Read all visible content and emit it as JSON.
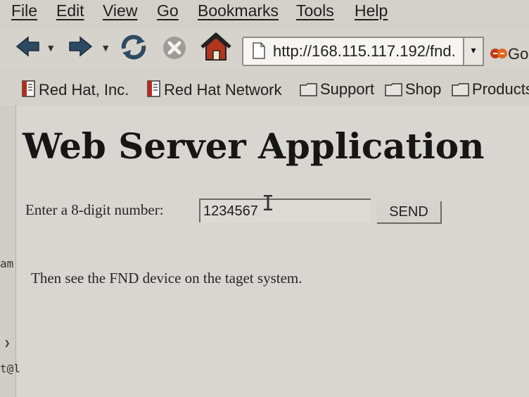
{
  "menubar": {
    "items": [
      "File",
      "Edit",
      "View",
      "Go",
      "Bookmarks",
      "Tools",
      "Help"
    ]
  },
  "toolbar": {
    "back_icon": "back-arrow-icon",
    "forward_icon": "forward-arrow-icon",
    "reload_icon": "reload-icon",
    "stop_icon": "stop-icon",
    "home_icon": "home-icon",
    "url": "http://168.115.117.192/fnd.",
    "go_label": "Go"
  },
  "bookmarks": {
    "items": [
      {
        "label": "Red Hat, Inc.",
        "icon": "bookmark-page-icon"
      },
      {
        "label": "Red Hat Network",
        "icon": "bookmark-page-icon"
      },
      {
        "label": "Support",
        "icon": "folder-icon"
      },
      {
        "label": "Shop",
        "icon": "folder-icon"
      },
      {
        "label": "Products",
        "icon": "folder-icon"
      }
    ]
  },
  "page": {
    "title": "Web Server Application",
    "prompt_label": "Enter a 8-digit number:",
    "input_value": "1234567",
    "send_label": "SEND",
    "hint": "Then see the FND device on the taget system."
  },
  "side_fragments": {
    "top": "am",
    "bottom": "t@l"
  },
  "colors": {
    "chrome": "#d3d0c9",
    "content_bg": "#d8d6d1",
    "home_icon": "#b2361e",
    "nav_arrow": "#2e4a63"
  }
}
